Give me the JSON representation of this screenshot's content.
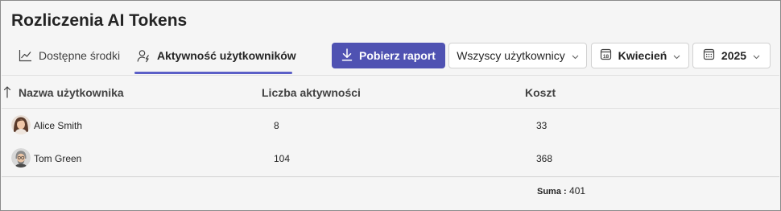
{
  "page": {
    "title": "Rozliczenia AI Tokens"
  },
  "tabs": [
    {
      "label": "Dostępne środki",
      "icon": "line-chart-icon",
      "active": false
    },
    {
      "label": "Aktywność użytkowników",
      "icon": "user-activity-icon",
      "active": true
    }
  ],
  "toolbar": {
    "download_label": "Pobierz raport",
    "users_filter": "Wszyscy użytkownicy",
    "month_filter": "Kwiecień",
    "year_filter": "2025",
    "accent_color": "#4f52b2"
  },
  "table": {
    "columns": [
      "Nazwa użytkownika",
      "Liczba aktywności",
      "Koszt"
    ],
    "sort_column": "Nazwa użytkownika",
    "sort_direction": "ascending",
    "rows": [
      {
        "name": "Alice Smith",
        "activities": "8",
        "cost": "33"
      },
      {
        "name": "Tom Green",
        "activities": "104",
        "cost": "368"
      }
    ],
    "total_label": "Suma :",
    "total_value": "401"
  }
}
